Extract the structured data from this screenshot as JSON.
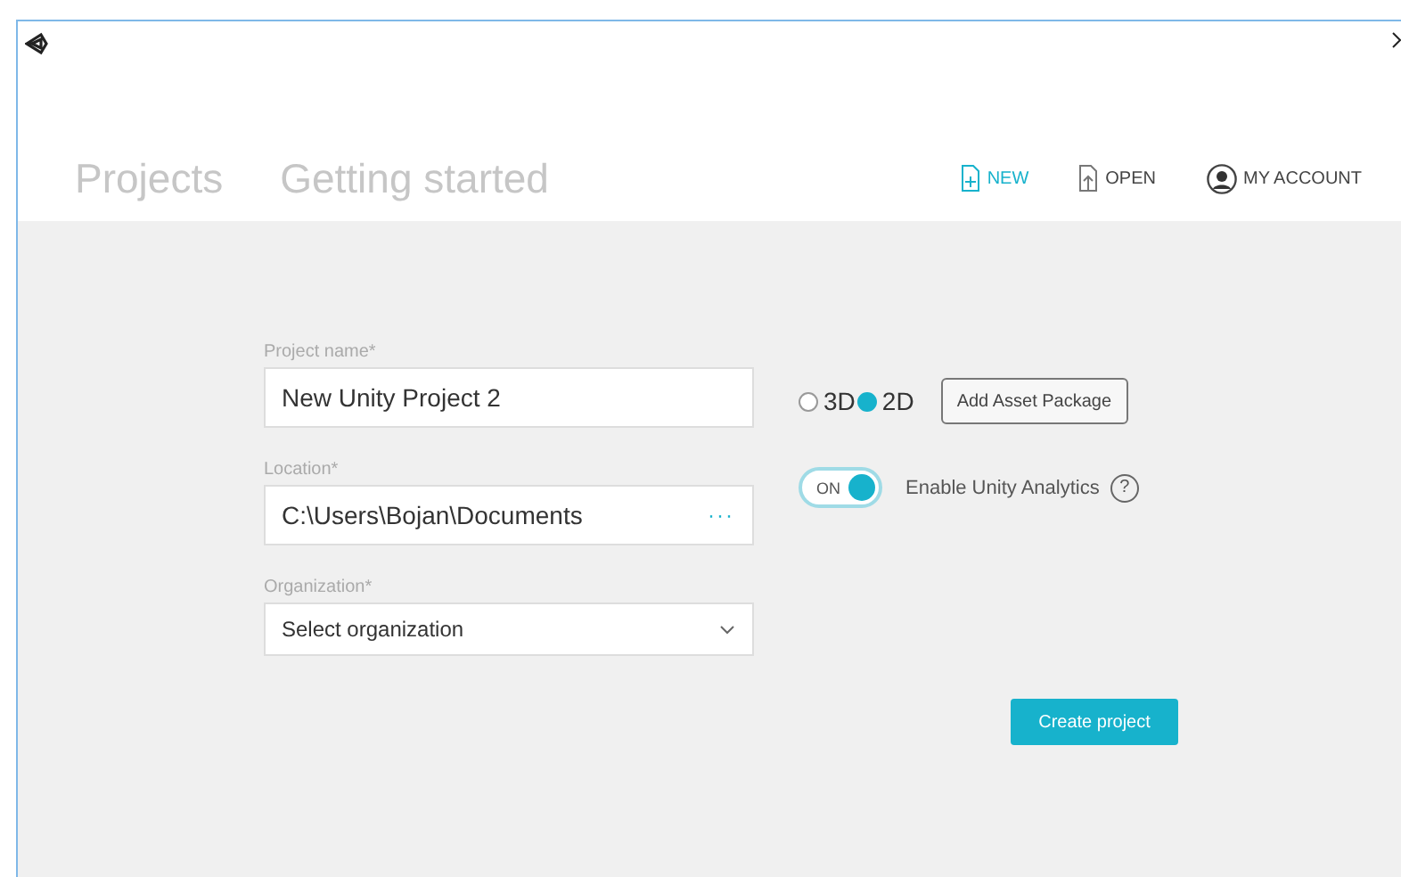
{
  "tabs": [
    {
      "label": "Projects"
    },
    {
      "label": "Getting started"
    }
  ],
  "actions": [
    {
      "kind": "new",
      "label": "NEW",
      "active": true
    },
    {
      "kind": "open",
      "label": "OPEN",
      "active": false
    },
    {
      "kind": "account",
      "label": "MY ACCOUNT",
      "active": false
    }
  ],
  "fields": [
    {
      "kind": "text",
      "label": "Project name*",
      "value": "New Unity Project 2"
    },
    {
      "kind": "browse",
      "label": "Location*",
      "value": "C:\\Users\\Bojan\\Documents",
      "button": "···"
    },
    {
      "kind": "select",
      "label": "Organization*",
      "value": "Select organization"
    }
  ],
  "templates": [
    {
      "label": "3D",
      "selected": false
    },
    {
      "label": "2D",
      "selected": true
    }
  ],
  "asset_button": "Add Asset Package",
  "analytics": {
    "on": true,
    "switch_label": "ON",
    "label": "Enable Unity Analytics",
    "help": "?"
  },
  "create_button": "Create project"
}
